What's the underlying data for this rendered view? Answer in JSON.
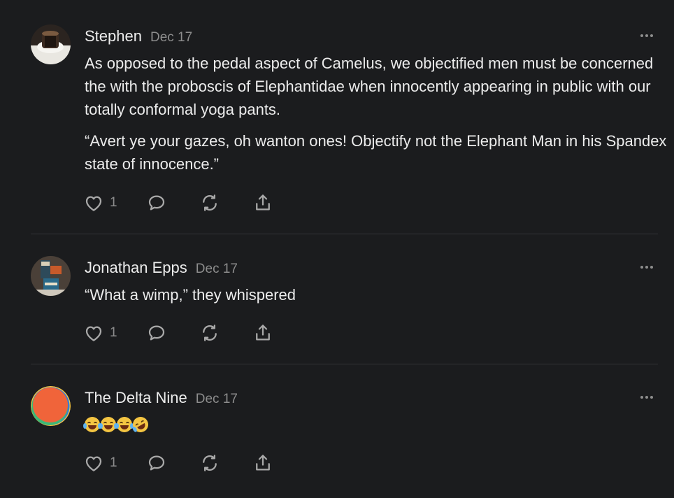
{
  "comments": [
    {
      "author": "Stephen",
      "date": "Dec 17",
      "paragraphs": [
        "As opposed to the pedal aspect of Camelus, we objectified men must be concerned the with the proboscis of Elephantidae when innocently appearing in public with our totally conformal yoga pants.",
        "“Avert ye your gazes, oh wanton ones! Objectify not the Elephant Man in his Spandex state of innocence.”"
      ],
      "likes": "1",
      "avatar_colors": [
        "#3a2b22",
        "#f2f2ee"
      ]
    },
    {
      "author": "Jonathan Epps",
      "date": "Dec 17",
      "paragraphs": [
        "“What a wimp,” they whispered"
      ],
      "likes": "1",
      "avatar_colors": [
        "#4a4038",
        "#c85a2a",
        "#2a6a8a"
      ]
    },
    {
      "author": "The Delta Nine",
      "date": "Dec 17",
      "emoji": [
        "tears-of-joy",
        "tears-of-joy",
        "tears-of-joy",
        "rolling-on-floor-laughing"
      ],
      "likes": "1",
      "avatar_colors": [
        "#f0643a",
        "#3cb878",
        "#3a7bd5",
        "#f4c542"
      ]
    }
  ],
  "icons": {
    "like": "heart-icon",
    "reply": "comment-bubble-icon",
    "restack": "restack-icon",
    "share": "share-icon",
    "more": "more-dots-icon"
  },
  "colors": {
    "background": "#1b1c1e",
    "text": "#ececec",
    "muted": "#8d8d8d",
    "divider": "#333437"
  }
}
